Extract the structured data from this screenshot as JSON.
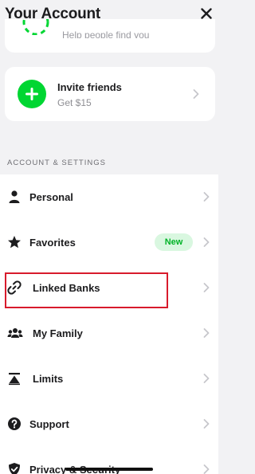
{
  "header": {
    "title": "Your Account",
    "close_icon": "close-icon"
  },
  "top_card": {
    "text": "Help people find you",
    "icon": "people-icon",
    "accent": "#00d632"
  },
  "invite": {
    "title": "Invite friends",
    "subtitle": "Get $15",
    "icon": "plus-icon",
    "accent": "#00d632"
  },
  "section": {
    "label": "ACCOUNT & SETTINGS"
  },
  "rows": [
    {
      "label": "Personal",
      "icon": "person-icon"
    },
    {
      "label": "Favorites",
      "icon": "star-icon",
      "badge": "New"
    },
    {
      "label": "Linked Banks",
      "icon": "link-icon",
      "highlighted": true
    },
    {
      "label": "My Family",
      "icon": "family-icon"
    },
    {
      "label": "Limits",
      "icon": "limits-icon"
    },
    {
      "label": "Support",
      "icon": "support-icon"
    },
    {
      "label": "Privacy & Security",
      "icon": "shield-icon"
    }
  ],
  "colors": {
    "highlight": "#d81b2c",
    "badge_bg": "#d9f7e0",
    "badge_text": "#00b327"
  }
}
